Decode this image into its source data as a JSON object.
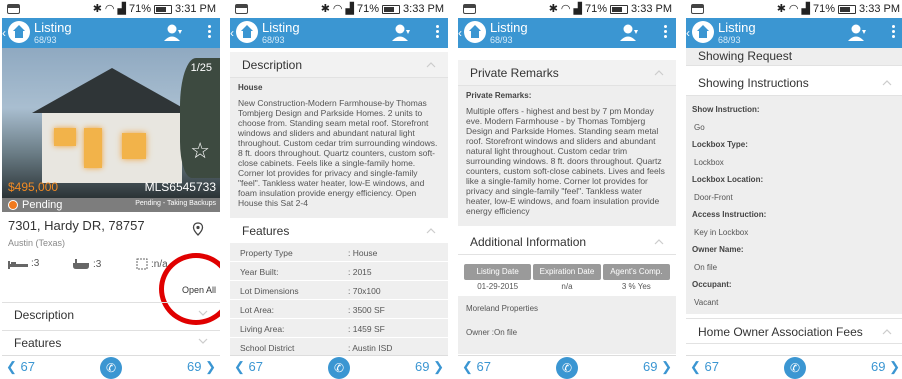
{
  "status_bar": {
    "battery": "71%",
    "times": [
      "3:31 PM",
      "3:33 PM",
      "3:33 PM",
      "3:33 PM"
    ]
  },
  "app_bar": {
    "title": "Listing",
    "position": "68/93"
  },
  "bottom_nav": {
    "prev": "67",
    "next": "69"
  },
  "screen1": {
    "photo_counter": "1/25",
    "price": "$495,000",
    "mls": "MLS6545733",
    "status": "Pending",
    "status_detail": "Pending - Taking Backups",
    "address": "7301, Hardy DR, 78757",
    "city": "Austin (Texas)",
    "beds": ":3",
    "baths": ":3",
    "sqft": ":n/a",
    "open_all": "Open All",
    "sections": [
      "Description",
      "Features"
    ]
  },
  "screen2": {
    "description_header": "Description",
    "description_type": "House",
    "description_text": "New Construction-Modern Farmhouse-by Thomas Tombjerg Design and Parkside Homes. 2 units to choose from. Standing seam metal roof. Storefront windows and sliders and abundant natural light throughout. Custom cedar trim surrounding windows. 8 ft. doors throughout. Quartz counters, custom soft-close cabinets. Feels like a single-family home. Corner lot provides for privacy and single-family \"feel\". Tankless water heater, low-E windows, and foam insulation provide energy efficiency. Open House this Sat 2-4",
    "features_header": "Features",
    "features": [
      {
        "key": "Property Type",
        "value": ": House"
      },
      {
        "key": "Year Built:",
        "value": ": 2015"
      },
      {
        "key": "Lot Dimensions",
        "value": ": 70x100"
      },
      {
        "key": "Lot Area:",
        "value": ": 3500 SF"
      },
      {
        "key": "Living Area:",
        "value": ": 1459 SF"
      },
      {
        "key": "School District",
        "value": ": Austin ISD"
      }
    ]
  },
  "screen3": {
    "remarks_header": "Private Remarks",
    "remarks_label": "Private Remarks:",
    "remarks_text": "Multiple offers - highest and best by 7 pm Monday eve. Modern Farmhouse - by Thomas Tombjerg Design and Parkside Homes. Standing seam metal roof. Storefront windows and sliders and abundant natural light throughout. Custom cedar trim surrounding windows. 8 ft. doors throughout. Quartz counters, custom soft-close cabinets. Lives and feels like a single-family home. Corner lot provides for privacy and single-family \"feel\". Tankless water heater, low-E windows, and foam insulation provide energy efficiency",
    "additional_header": "Additional Information",
    "cols": [
      "Listing Date",
      "Expiration Date",
      "Agent's Comp."
    ],
    "vals": [
      "01-29-2015",
      "n/a",
      "3 % Yes"
    ],
    "company": "Moreland Properties",
    "owner": "Owner :On file"
  },
  "screen4": {
    "top_partial": "Showing Request",
    "header": "Showing Instructions",
    "fields": [
      {
        "key": "Show Instruction:",
        "value": "Go"
      },
      {
        "key": "Lockbox Type:",
        "value": "Lockbox"
      },
      {
        "key": "Lockbox Location:",
        "value": "Door-Front"
      },
      {
        "key": "Access Instruction:",
        "value": "Key in Lockbox"
      },
      {
        "key": "Owner Name:",
        "value": "On file"
      },
      {
        "key": "Occupant:",
        "value": "Vacant"
      }
    ],
    "hoa_header": "Home Owner Association Fees"
  },
  "colors": {
    "primary": "#3b96d2",
    "accent": "#f08a24",
    "highlight": "#e00000"
  },
  "icons": [
    "notification-icon",
    "bluetooth-icon",
    "wifi-icon",
    "signal-icon",
    "battery-icon",
    "home-logo-icon",
    "user-pin-icon",
    "menu-icon",
    "phone-icon",
    "star-icon",
    "map-pin-icon",
    "bed-icon",
    "bath-icon",
    "area-icon",
    "chevron-up-icon",
    "chevron-down-icon"
  ]
}
